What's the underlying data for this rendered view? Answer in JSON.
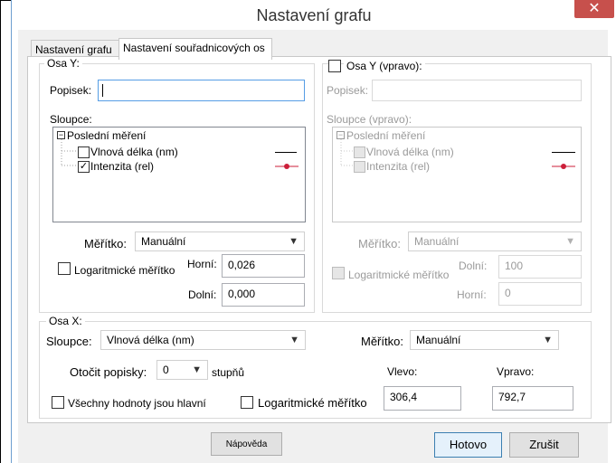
{
  "window": {
    "title": "Nastavení grafu",
    "close_symbol": "✕"
  },
  "tabs": [
    {
      "label": "Nastavení grafu"
    },
    {
      "label": "Nastavení souřadnicových os"
    }
  ],
  "y_axis": {
    "group_label": "Osa Y:",
    "caption_label": "Popisek:",
    "caption_value": "",
    "columns_label": "Sloupce:",
    "tree_root": "Poslední měření",
    "tree_items": [
      {
        "label": "Vlnová délka (nm)",
        "checked": false
      },
      {
        "label": "Intenzita (rel)",
        "checked": true
      }
    ],
    "scale_label": "Měřítko:",
    "scale_value": "Manuální",
    "log_label": "Logaritmické měřítko",
    "upper_label": "Horní:",
    "upper_value": "0,026",
    "lower_label": "Dolní:",
    "lower_value": "0,000",
    "series_color": "#cc1f3a"
  },
  "y_right_axis": {
    "group_label": "Osa Y (vpravo):",
    "caption_label": "Popisek:",
    "caption_value": "",
    "columns_label": "Sloupce (vpravo):",
    "tree_root": "Poslední měření",
    "tree_items": [
      {
        "label": "Vlnová délka (nm)",
        "checked": false
      },
      {
        "label": "Intenzita (rel)",
        "checked": false
      }
    ],
    "scale_label": "Měřítko:",
    "scale_value": "Manuální",
    "log_label": "Logaritmické měřítko",
    "lower_label": "Dolní:",
    "lower_value": "100",
    "upper_label": "Horní:",
    "upper_value": "0"
  },
  "x_axis": {
    "group_label": "Osa X:",
    "columns_label": "Sloupce:",
    "columns_value": "Vlnová délka (nm)",
    "scale_label": "Měřítko:",
    "scale_value": "Manuální",
    "rotate_label": "Otočit popisky:",
    "rotate_value": "0",
    "rotate_unit": "stupňů",
    "left_label": "Vlevo:",
    "left_value": "306,4",
    "right_label": "Vpravo:",
    "right_value": "792,7",
    "all_major_label": "Všechny hodnoty jsou hlavní",
    "log_label": "Logaritmické měřítko"
  },
  "buttons": {
    "help": "Nápověda",
    "ok": "Hotovo",
    "cancel": "Zrušit"
  },
  "colors": {
    "accent": "#569de5",
    "close": "#c7504c",
    "series": "#cc1f3a"
  }
}
